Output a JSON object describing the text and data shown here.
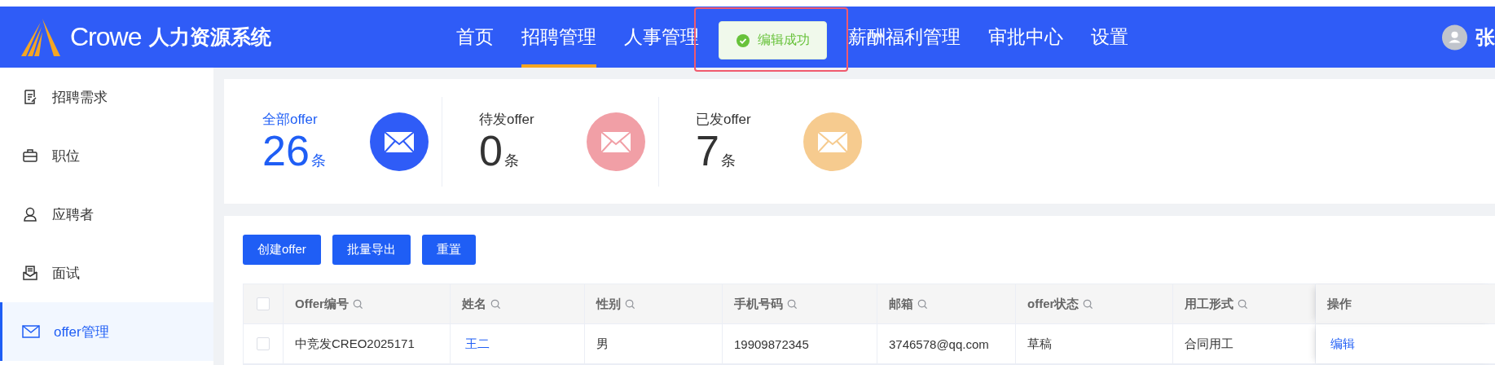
{
  "header": {
    "brand": "Crowe",
    "system_name": "人力资源系统",
    "nav": [
      {
        "label": "首页",
        "selected": false
      },
      {
        "label": "招聘管理",
        "selected": true
      },
      {
        "label": "人事管理",
        "selected": false
      },
      {
        "label": "薪酬福利管理",
        "selected": false
      },
      {
        "label": "审批中心",
        "selected": false
      },
      {
        "label": "设置",
        "selected": false
      }
    ],
    "user_name": "张"
  },
  "toast": {
    "message": "编辑成功"
  },
  "sidebar": {
    "items": [
      {
        "label": "招聘需求",
        "kind": "requirement",
        "selected": false
      },
      {
        "label": "职位",
        "kind": "position",
        "selected": false
      },
      {
        "label": "应聘者",
        "kind": "applicant",
        "selected": false
      },
      {
        "label": "面试",
        "kind": "interview",
        "selected": false
      },
      {
        "label": "offer管理",
        "kind": "offer",
        "selected": true
      }
    ]
  },
  "stats": [
    {
      "label": "全部offer",
      "count": "26",
      "unit": "条",
      "color": "#2f5cf7",
      "selected": true
    },
    {
      "label": "待发offer",
      "count": "0",
      "unit": "条",
      "color": "#f19fa6",
      "selected": false
    },
    {
      "label": "已发offer",
      "count": "7",
      "unit": "条",
      "color": "#f6cb8f",
      "selected": false
    }
  ],
  "buttons": [
    "创建offer",
    "批量导出",
    "重置"
  ],
  "table": {
    "select_all_checked": false,
    "columns": [
      {
        "label": "Offer编号",
        "searchable": true
      },
      {
        "label": "姓名",
        "searchable": true
      },
      {
        "label": "性别",
        "searchable": true
      },
      {
        "label": "手机号码",
        "searchable": true
      },
      {
        "label": "邮箱",
        "searchable": true
      },
      {
        "label": "offer状态",
        "searchable": true
      },
      {
        "label": "用工形式",
        "searchable": true
      },
      {
        "label": "操作",
        "searchable": false
      }
    ],
    "rows": [
      {
        "checked": false,
        "cells": [
          "中竞发CREO2025171",
          "王二",
          "男",
          "19909872345",
          "3746578@qq.com",
          "草稿",
          "合同用工"
        ],
        "action": "编辑"
      }
    ]
  }
}
